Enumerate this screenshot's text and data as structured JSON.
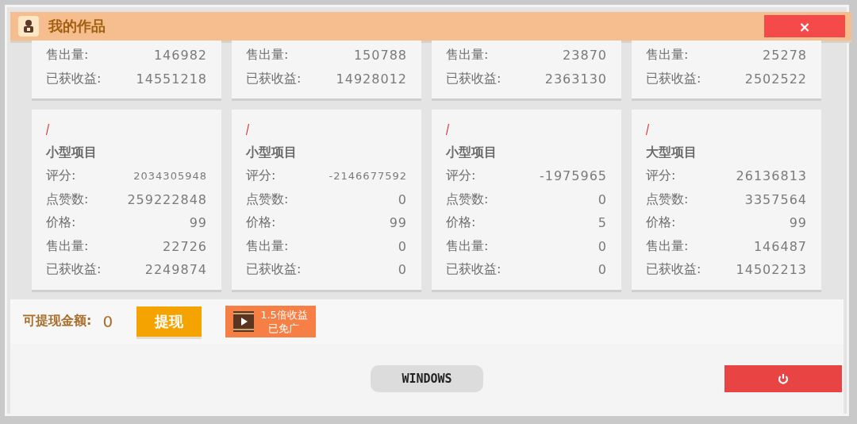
{
  "window": {
    "title": "我的作品",
    "close": "×"
  },
  "top_cards": [
    {
      "stats": [
        {
          "label": "售出量:",
          "value": "146982"
        },
        {
          "label": "已获收益:",
          "value": "14551218"
        }
      ]
    },
    {
      "stats": [
        {
          "label": "售出量:",
          "value": "150788"
        },
        {
          "label": "已获收益:",
          "value": "14928012"
        }
      ]
    },
    {
      "stats": [
        {
          "label": "售出量:",
          "value": "23870"
        },
        {
          "label": "已获收益:",
          "value": "2363130"
        }
      ]
    },
    {
      "stats": [
        {
          "label": "售出量:",
          "value": "25278"
        },
        {
          "label": "已获收益:",
          "value": "2502522"
        }
      ]
    }
  ],
  "cards": [
    {
      "type": "小型项目",
      "stats": [
        {
          "label": "评分:",
          "value": "2034305948"
        },
        {
          "label": "点赞数:",
          "value": "259222848"
        },
        {
          "label": "价格:",
          "value": "99"
        },
        {
          "label": "售出量:",
          "value": "22726"
        },
        {
          "label": "已获收益:",
          "value": "2249874"
        }
      ]
    },
    {
      "type": "小型项目",
      "stats": [
        {
          "label": "评分:",
          "value": "-2146677592"
        },
        {
          "label": "点赞数:",
          "value": "0"
        },
        {
          "label": "价格:",
          "value": "99"
        },
        {
          "label": "售出量:",
          "value": "0"
        },
        {
          "label": "已获收益:",
          "value": "0"
        }
      ]
    },
    {
      "type": "小型项目",
      "stats": [
        {
          "label": "评分:",
          "value": "-1975965"
        },
        {
          "label": "点赞数:",
          "value": "0"
        },
        {
          "label": "价格:",
          "value": "5"
        },
        {
          "label": "售出量:",
          "value": "0"
        },
        {
          "label": "已获收益:",
          "value": "0"
        }
      ]
    },
    {
      "type": "大型项目",
      "stats": [
        {
          "label": "评分:",
          "value": "26136813"
        },
        {
          "label": "点赞数:",
          "value": "3357564"
        },
        {
          "label": "价格:",
          "value": "99"
        },
        {
          "label": "售出量:",
          "value": "146487"
        },
        {
          "label": "已获收益:",
          "value": "14502213"
        }
      ]
    }
  ],
  "withdraw": {
    "label": "可提现金额:",
    "amount": "0",
    "button": "提现",
    "bonus_line1": "1.5倍收益",
    "bonus_line2": "已免广"
  },
  "footer": {
    "platform": "WINDOWS"
  }
}
